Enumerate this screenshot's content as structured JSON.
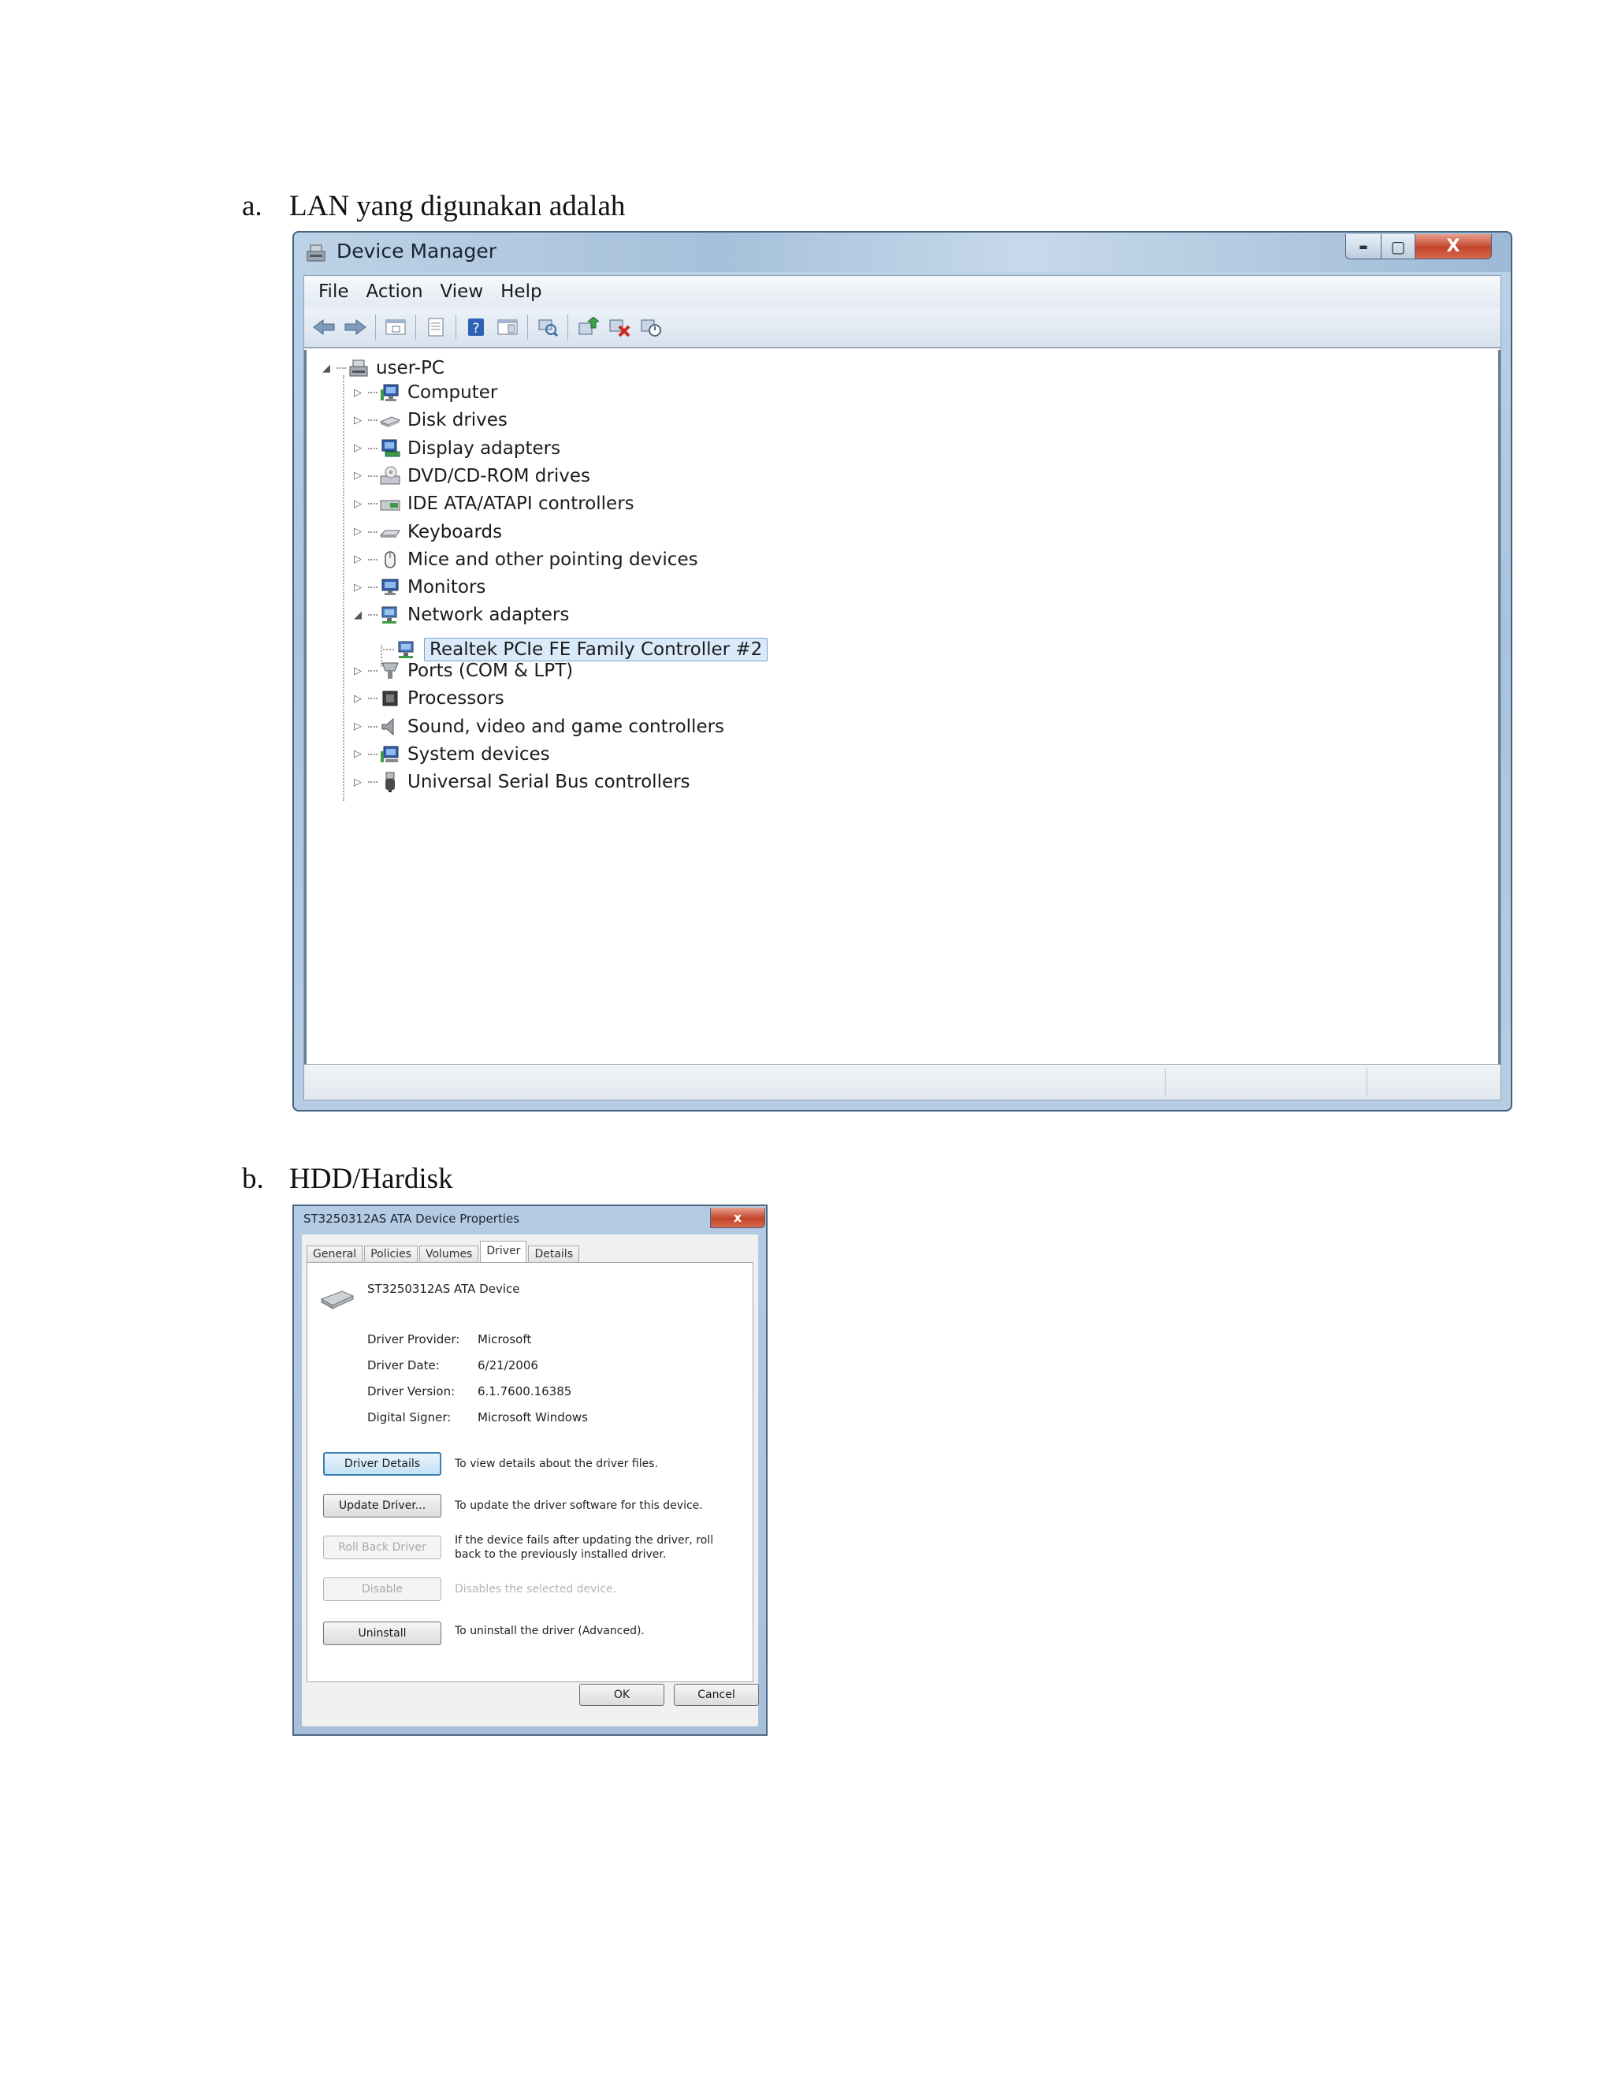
{
  "captions": {
    "a": {
      "label": "a.",
      "text": "LAN yang digunakan  adalah"
    },
    "b": {
      "label": "b.",
      "text": "HDD/Hardisk"
    }
  },
  "device_manager": {
    "title": "Device Manager",
    "caption_buttons": {
      "minimize": "▬",
      "maximize": "▢",
      "close": "X"
    },
    "menu": [
      "File",
      "Action",
      "View",
      "Help"
    ],
    "toolbar_icons": [
      "back-arrow-icon",
      "forward-arrow-icon",
      "show-hide-console-tree-icon",
      "properties-icon",
      "help-icon",
      "action-pane-icon",
      "scan-hardware-changes-icon",
      "update-driver-icon",
      "uninstall-icon",
      "disable-device-icon"
    ],
    "root": "user-PC",
    "categories": [
      {
        "label": "Computer",
        "icon": "computer-icon",
        "expanded": false
      },
      {
        "label": "Disk drives",
        "icon": "disk-drive-icon",
        "expanded": false
      },
      {
        "label": "Display adapters",
        "icon": "display-adapter-icon",
        "expanded": false
      },
      {
        "label": "DVD/CD-ROM drives",
        "icon": "dvd-drive-icon",
        "expanded": false
      },
      {
        "label": "IDE ATA/ATAPI controllers",
        "icon": "ide-controller-icon",
        "expanded": false
      },
      {
        "label": "Keyboards",
        "icon": "keyboard-icon",
        "expanded": false
      },
      {
        "label": "Mice and other pointing devices",
        "icon": "mouse-icon",
        "expanded": false
      },
      {
        "label": "Monitors",
        "icon": "monitor-icon",
        "expanded": false
      },
      {
        "label": "Network adapters",
        "icon": "network-adapter-icon",
        "expanded": true
      },
      {
        "label": "Ports (COM & LPT)",
        "icon": "port-icon",
        "expanded": false
      },
      {
        "label": "Processors",
        "icon": "processor-icon",
        "expanded": false
      },
      {
        "label": "Sound, video and game controllers",
        "icon": "speaker-icon",
        "expanded": false
      },
      {
        "label": "System devices",
        "icon": "system-device-icon",
        "expanded": false
      },
      {
        "label": "Universal Serial Bus controllers",
        "icon": "usb-icon",
        "expanded": false
      }
    ],
    "selected_child": "Realtek PCIe FE Family Controller #2"
  },
  "properties": {
    "title": "ST3250312AS ATA Device Properties",
    "close_label": "x",
    "tabs": [
      "General",
      "Policies",
      "Volumes",
      "Driver",
      "Details"
    ],
    "active_tab": "Driver",
    "device_name": "ST3250312AS ATA Device",
    "fields": [
      {
        "label": "Driver Provider:",
        "value": "Microsoft"
      },
      {
        "label": "Driver Date:",
        "value": "6/21/2006"
      },
      {
        "label": "Driver Version:",
        "value": "6.1.7600.16385"
      },
      {
        "label": "Digital Signer:",
        "value": "Microsoft Windows"
      }
    ],
    "actions": [
      {
        "button": "Driver Details",
        "desc": "To view details about the driver files.",
        "enabled": true
      },
      {
        "button": "Update Driver...",
        "desc": "To update the driver software for this device.",
        "enabled": true
      },
      {
        "button": "Roll Back Driver",
        "desc": "If the device fails after updating the driver, roll back to the previously installed driver.",
        "enabled": false
      },
      {
        "button": "Disable",
        "desc": "Disables the selected device.",
        "enabled": false
      },
      {
        "button": "Uninstall",
        "desc": "To uninstall the driver (Advanced).",
        "enabled": true
      }
    ],
    "ok": "OK",
    "cancel": "Cancel"
  }
}
